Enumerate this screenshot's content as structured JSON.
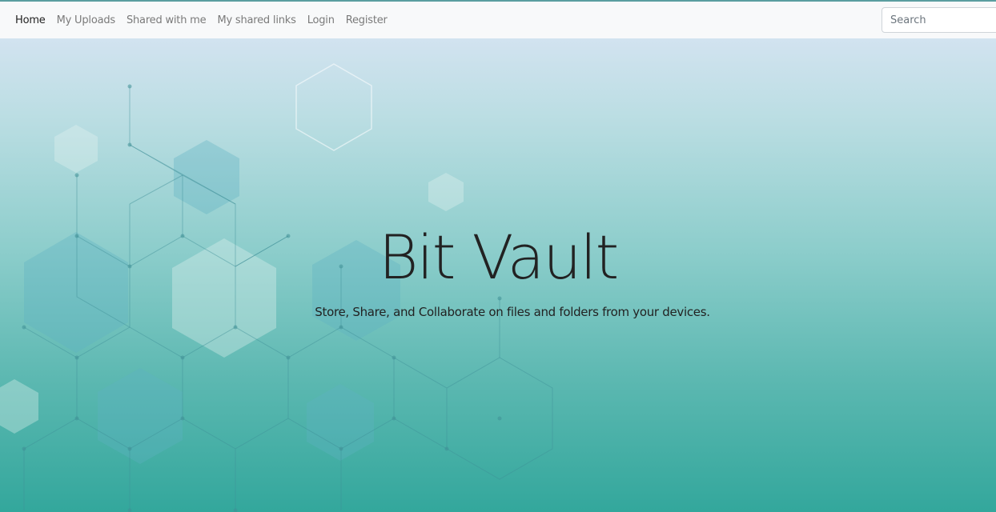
{
  "nav": {
    "links": [
      {
        "label": "Home",
        "active": true
      },
      {
        "label": "My Uploads",
        "active": false
      },
      {
        "label": "Shared with me",
        "active": false
      },
      {
        "label": "My shared links",
        "active": false
      },
      {
        "label": "Login",
        "active": false
      },
      {
        "label": "Register",
        "active": false
      }
    ],
    "search_placeholder": "Search",
    "search_value": ""
  },
  "hero": {
    "title": "Bit Vault",
    "subtitle": "Store, Share, and Collaborate on files and folders from your devices."
  },
  "colors": {
    "navbar_bg": "#f8f9fa",
    "hero_top": "#d2e3f0",
    "hero_bottom": "#33a79c",
    "text": "#222222",
    "nav_inactive": "#7a7a7a"
  }
}
